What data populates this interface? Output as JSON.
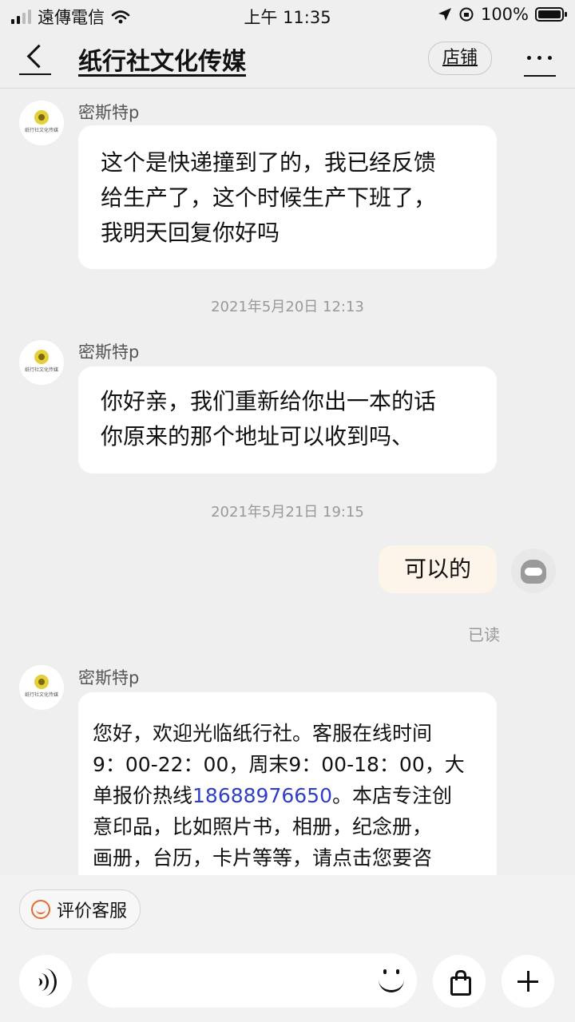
{
  "status_bar": {
    "carrier": "遠傳電信",
    "time": "上午 11:35",
    "battery": "100%"
  },
  "header": {
    "title": "纸行社文化传媒",
    "shop_label": "店铺",
    "back_icon": "back-arrow-icon",
    "more_icon": "more-dots-icon"
  },
  "messages": [
    {
      "sender": "密斯特p",
      "lines": [
        "这个是快递撞到了的，我已经反馈",
        "给生产了，这个时候生产下班了，",
        "我明天回复你好吗"
      ]
    },
    {
      "timestamp": "2021年5月20日 12:13"
    },
    {
      "sender": "密斯特p",
      "lines": [
        "你好亲，我们重新给你出一本的话",
        "你原来的那个地址可以收到吗、"
      ]
    },
    {
      "timestamp": "2021年5月21日 19:15"
    },
    {
      "self_text": "可以的",
      "status": "已读"
    },
    {
      "sender": "密斯特p",
      "line1": "您好，欢迎光临纸行社。客服在线时间",
      "line2": "9：00-22：00，周末9：00-18：00，大",
      "line3_before": "单报价热线",
      "phone": "18688976650",
      "line3_after": "。本店专注创",
      "line4": "意印品，比如照片书，相册，纪念册，",
      "line5": "画册，台历，卡片等等，请点击您要咨"
    }
  ],
  "footer": {
    "rate_button": "评价客服",
    "input_placeholder": "",
    "icons": [
      "voice-icon",
      "emoji-icon",
      "shopping-bag-icon",
      "plus-icon"
    ]
  },
  "colors": {
    "background": "#efefef",
    "incoming_bubble": "#ffffff",
    "outgoing_bubble": "#fdf5ea",
    "link": "#2f3ec8",
    "rate_icon": "#e86a2f"
  }
}
